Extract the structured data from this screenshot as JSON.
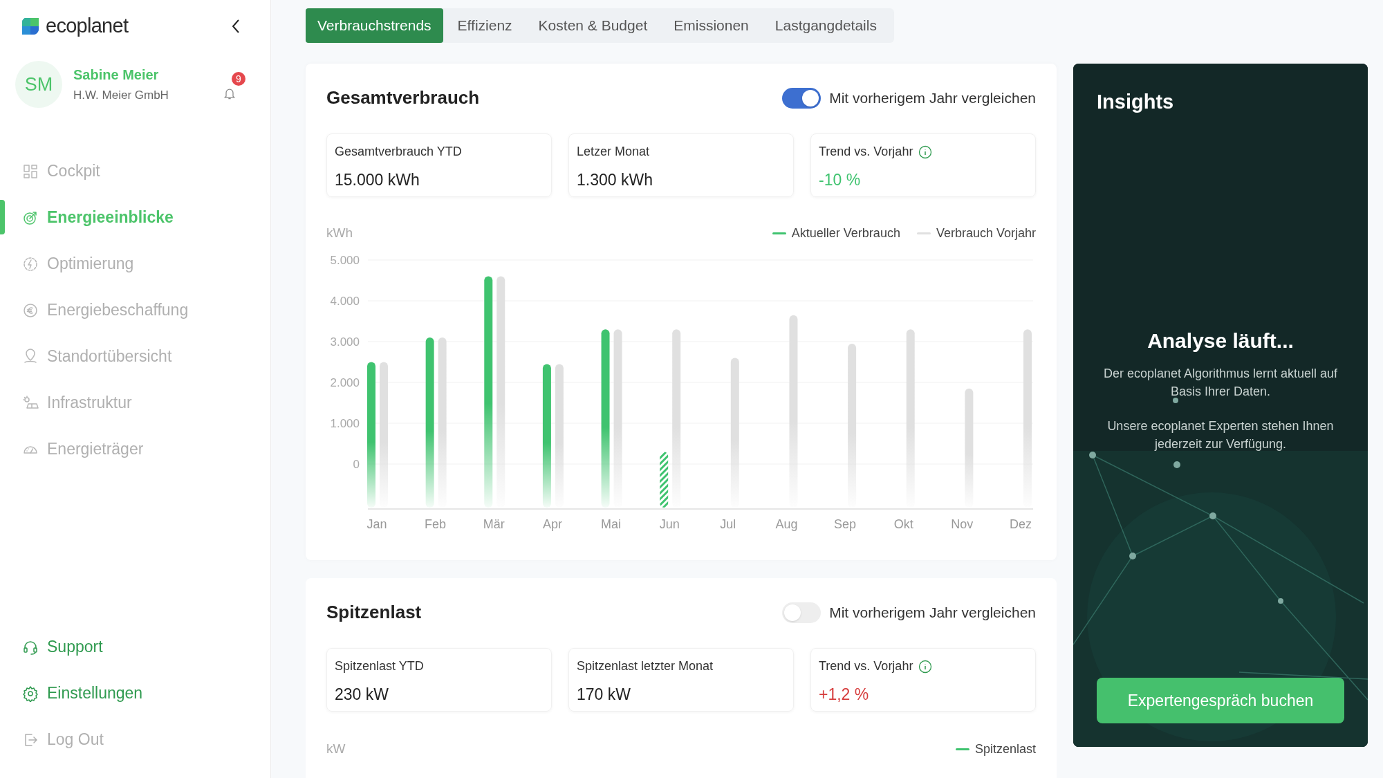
{
  "brand": "ecoplanet",
  "user": {
    "initials": "SM",
    "name": "Sabine Meier",
    "company": "H.W. Meier GmbH",
    "notifications": "9"
  },
  "nav": [
    {
      "label": "Cockpit",
      "selected": false
    },
    {
      "label": "Energieeinblicke",
      "selected": true
    },
    {
      "label": "Optimierung",
      "selected": false
    },
    {
      "label": "Energiebeschaffung",
      "selected": false
    },
    {
      "label": "Standortübersicht",
      "selected": false
    },
    {
      "label": "Infrastruktur",
      "selected": false
    },
    {
      "label": "Energieträger",
      "selected": false
    }
  ],
  "bottom_nav": [
    {
      "label": "Support",
      "active": true
    },
    {
      "label": "Einstellungen",
      "active": true
    },
    {
      "label": "Log Out",
      "active": false
    }
  ],
  "tabs": [
    {
      "label": "Verbrauchstrends",
      "selected": true
    },
    {
      "label": "Effizienz",
      "selected": false
    },
    {
      "label": "Kosten & Budget",
      "selected": false
    },
    {
      "label": "Emissionen",
      "selected": false
    },
    {
      "label": "Lastgangdetails",
      "selected": false
    }
  ],
  "consumption": {
    "title": "Gesamtverbrauch",
    "compare": {
      "label": "Mit vorherigem Jahr vergleichen",
      "on": true
    },
    "kpis": [
      {
        "label": "Gesamtverbrauch YTD",
        "value": "15.000 kWh",
        "color": "#222222",
        "info": false
      },
      {
        "label": "Letzer Monat",
        "value": "1.300 kWh",
        "color": "#222222",
        "info": false
      },
      {
        "label": "Trend vs. Vorjahr",
        "value": "-10 %",
        "color": "#3fc36f",
        "info": true
      }
    ],
    "unit": "kWh",
    "chart_data": {
      "type": "bar",
      "grid": true,
      "categories": [
        "Jan",
        "Feb",
        "Mär",
        "Apr",
        "Mai",
        "Jun",
        "Jul",
        "Aug",
        "Sep",
        "Okt",
        "Nov",
        "Dez"
      ],
      "series": [
        {
          "name": "Aktueller Verbrauch",
          "color": "#3fc36f",
          "values": [
            2500,
            3100,
            4600,
            2450,
            3300,
            300,
            null,
            null,
            null,
            null,
            null,
            null
          ]
        },
        {
          "name": "Verbrauch Vorjahr",
          "color": "#e0e0e0",
          "values": [
            2500,
            3100,
            4600,
            2450,
            3300,
            3300,
            2600,
            3650,
            2950,
            3300,
            1850,
            3300
          ]
        }
      ],
      "ylim": [
        0,
        5000
      ],
      "yticks": [
        {
          "value": 0,
          "label": "0"
        },
        {
          "value": 1000,
          "label": "1.000"
        },
        {
          "value": 2000,
          "label": "2.000"
        },
        {
          "value": 3000,
          "label": "3.000"
        },
        {
          "value": 4000,
          "label": "4.000"
        },
        {
          "value": 5000,
          "label": "5.000"
        }
      ]
    }
  },
  "peak": {
    "title": "Spitzenlast",
    "compare": {
      "label": "Mit vorherigem Jahr vergleichen",
      "on": false
    },
    "kpis": [
      {
        "label": "Spitzenlast YTD",
        "value": "230 kW",
        "color": "#222222",
        "info": false
      },
      {
        "label": "Spitzenlast letzter Monat",
        "value": "170 kW",
        "color": "#222222",
        "info": false
      },
      {
        "label": "Trend vs. Vorjahr",
        "value": "+1,2 %",
        "color": "#d63c3c",
        "info": true
      }
    ],
    "unit": "kW",
    "legend": {
      "label": "Spitzenlast",
      "color": "#3fc36f"
    }
  },
  "insights": {
    "title": "Insights",
    "heading": "Analyse läuft...",
    "paragraphs": [
      "Der ecoplanet Algorithmus lernt aktuell auf Basis Ihrer Daten.",
      "Unsere ecoplanet Experten stehen Ihnen jederzeit zur Verfügung."
    ],
    "button": "Expertengespräch buchen"
  }
}
